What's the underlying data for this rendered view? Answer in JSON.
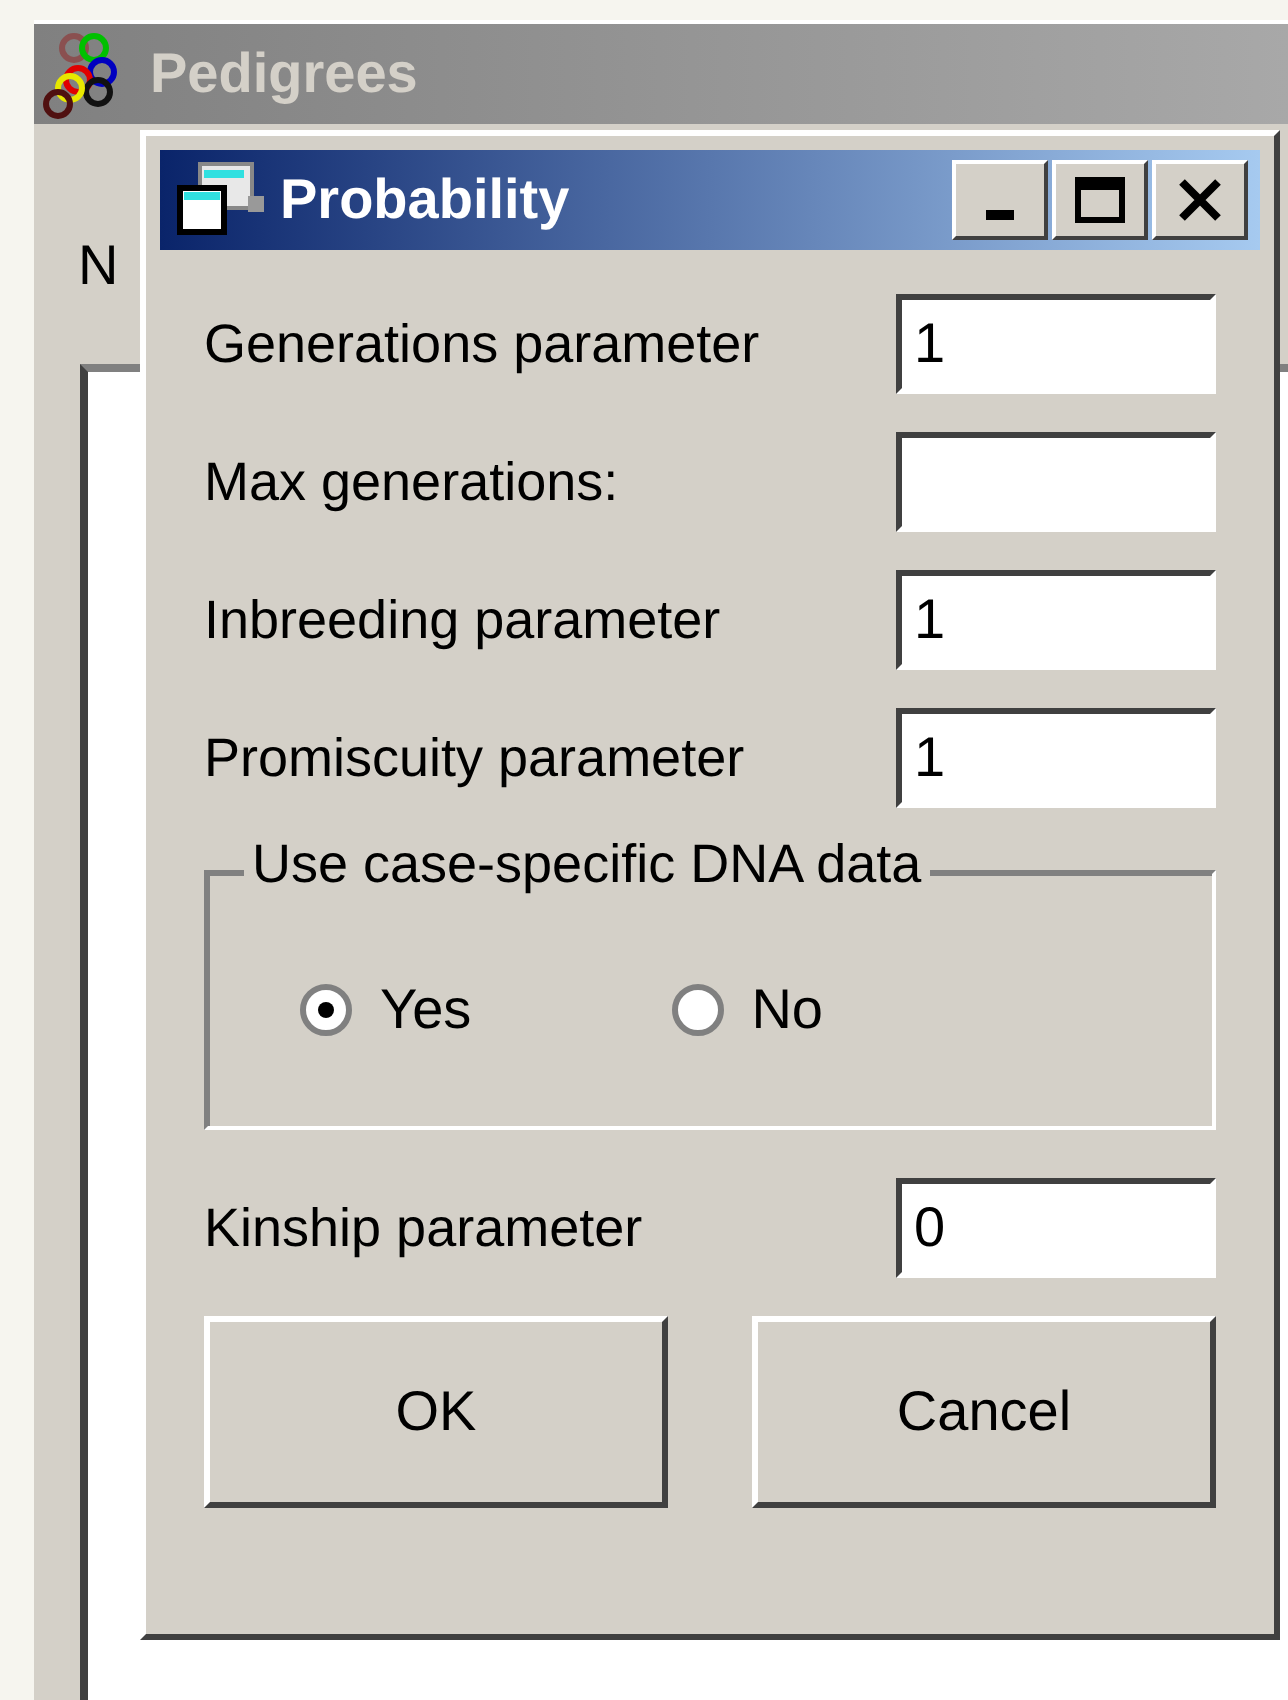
{
  "parent_window": {
    "title": "Pedigrees",
    "label": "N"
  },
  "dialog": {
    "title": "Probability",
    "fields": [
      {
        "label": "Generations parameter",
        "value": "1"
      },
      {
        "label": "Max generations:"
      },
      {
        "label": "Inbreeding parameter",
        "value": "1"
      },
      {
        "label": "Promiscuity parameter",
        "value": "1"
      }
    ],
    "dna_group": {
      "title": "Use case-specific DNA data",
      "options": [
        {
          "label": "Yes",
          "selected": true
        },
        {
          "label": "No",
          "selected": false
        }
      ]
    },
    "kinship": {
      "label": "Kinship parameter",
      "value": "0"
    },
    "buttons": [
      "OK",
      "Cancel"
    ]
  }
}
